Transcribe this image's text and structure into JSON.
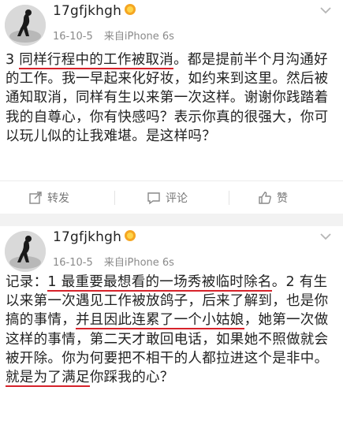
{
  "posts": [
    {
      "username": "17gfjkhgh",
      "time": "16-10-5",
      "source": "来自iPhone 6s",
      "text_pre": "3 ",
      "text_u1": "同样行程中的工作被取消",
      "text_mid": "。都是提前半个月沟通好的工作。我一早起来化好妆，如约来到这里。然后被通知取消，同样有生以来第一次这样。谢谢你践踏着我的自尊心，你有快感吗？表示你真的很强大，你可以玩儿似的让我难堪。是这样吗？",
      "actions": {
        "share": "转发",
        "comment": "评论",
        "like": "赞"
      }
    },
    {
      "username": "17gfjkhgh",
      "time": "16-10-5",
      "source": "来自iPhone 6s",
      "text_pre": "记录：",
      "text_u1": "1 最重要最想看的一场秀被临时除名",
      "text_mid1": "。2 有生以来第一次遇见工作被放鸽子，后来了解到，也是你搞的事情，",
      "text_u2": "并且因此连累了一个小姑娘",
      "text_mid2": "，她第一次做这样的事情，第二天才敢回电话，如果她不照做就会被开除。你为何要把不相干的人都拉进这个是非中。",
      "text_u3": "就是为了满足",
      "text_end": "你踩我的心？"
    }
  ],
  "colors": {
    "underline": "#d6222a",
    "meta": "#8a8a8a",
    "badge": "#f5a623"
  }
}
